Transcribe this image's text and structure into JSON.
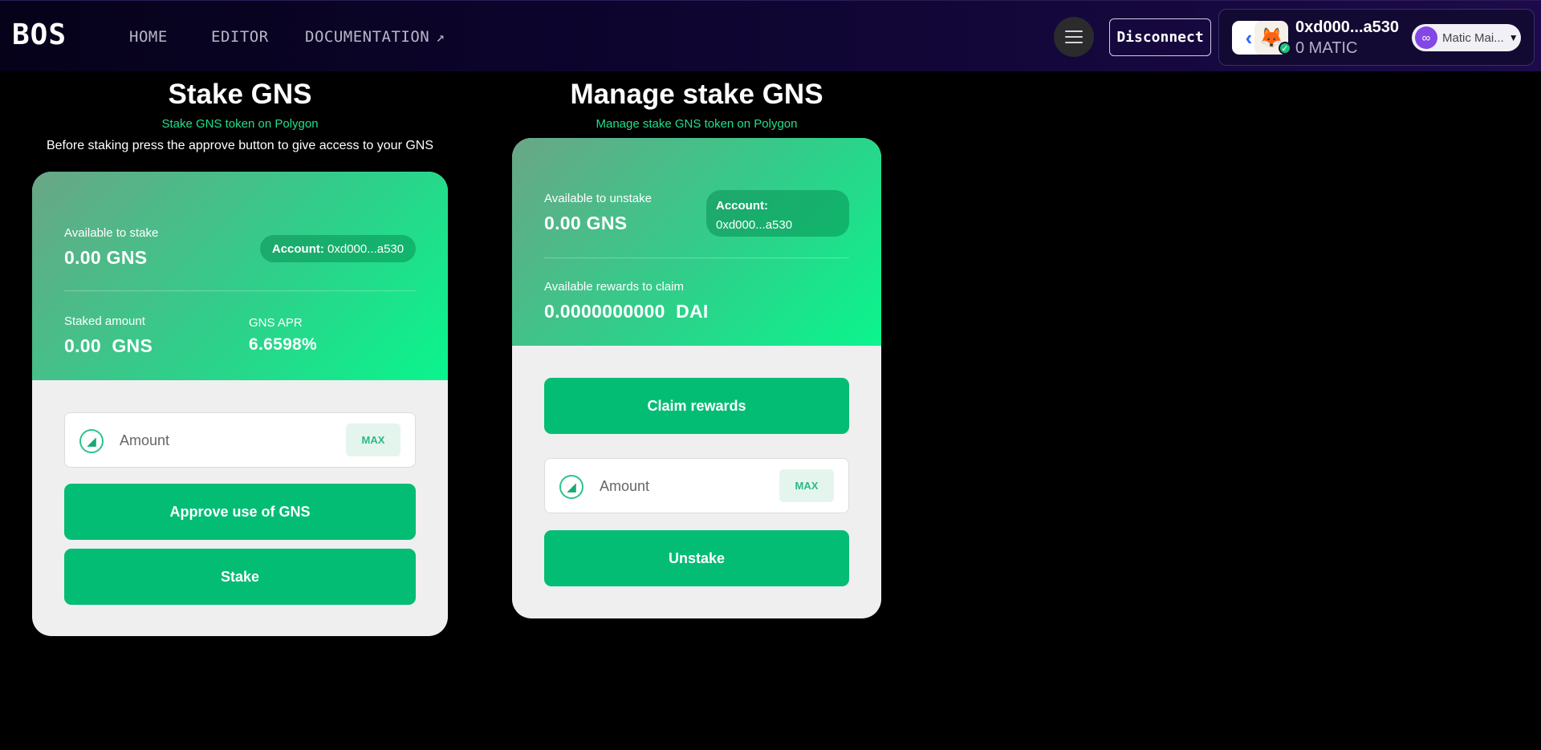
{
  "navbar": {
    "logo": "BOS",
    "links": {
      "home": "HOME",
      "editor": "EDITOR",
      "documentation": "DOCUMENTATION"
    },
    "disconnect_label": "Disconnect",
    "wallet": {
      "address": "0xd000...a530",
      "balance": "0 MATIC",
      "network": "Matic Mai..."
    }
  },
  "stake": {
    "title": "Stake GNS",
    "subtitle": "Stake GNS token on Polygon",
    "note": "Before staking press the approve button to give access to your GNS",
    "available_label": "Available to stake",
    "available_value": "0.00 GNS",
    "account_label": "Account:",
    "account_value": "0xd000...a530",
    "staked_label": "Staked amount",
    "staked_value": "0.00  GNS",
    "apr_label": "GNS APR",
    "apr_value": "6.6598%",
    "amount_placeholder": "Amount",
    "max_label": "MAX",
    "approve_label": "Approve use of GNS",
    "stake_label": "Stake"
  },
  "manage": {
    "title": "Manage stake GNS",
    "subtitle": "Manage stake GNS token on Polygon",
    "available_unstake_label": "Available to unstake",
    "available_unstake_value": "0.00 GNS",
    "account_label": "Account:",
    "account_value": "0xd000...a530",
    "rewards_label": "Available rewards to claim",
    "rewards_value": "0.0000000000  DAI",
    "claim_label": "Claim rewards",
    "amount_placeholder": "Amount",
    "max_label": "MAX",
    "unstake_label": "Unstake"
  },
  "colors": {
    "accent_green": "#04bd75",
    "subtitle_green": "#1fe08a",
    "nav_purple": "#1c0a4a"
  },
  "icons": {
    "menu": "hamburger-icon",
    "external": "external-link-icon",
    "wallet_a": "near-wallet-icon",
    "wallet_b": "metamask-fox-icon",
    "network": "polygon-icon",
    "token": "gns-token-icon"
  }
}
